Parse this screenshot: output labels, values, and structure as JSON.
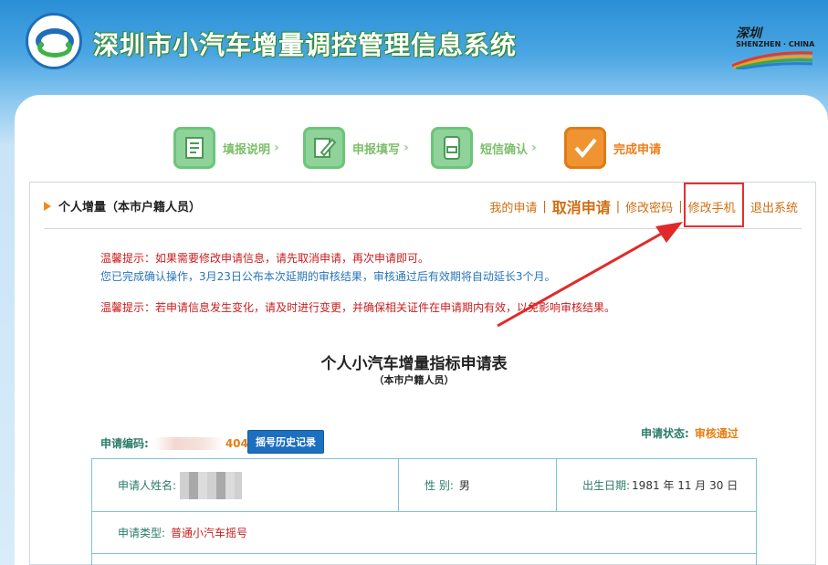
{
  "header": {
    "site_title": "深圳市小汽车增量调控管理信息系统",
    "brand_cn": "深圳",
    "brand_en": "SHENZHEN · CHINA"
  },
  "steps": [
    {
      "label": "填报说明",
      "icon": "document-icon",
      "active": false
    },
    {
      "label": "申报填写",
      "icon": "edit-form-icon",
      "active": false
    },
    {
      "label": "短信确认",
      "icon": "sms-phone-icon",
      "active": false
    },
    {
      "label": "完成申请",
      "icon": "checkmark-icon",
      "active": true
    }
  ],
  "section": {
    "title": "个人增量（本市户籍人员）"
  },
  "nav": {
    "my_application": "我的申请",
    "cancel_application": "取消申请",
    "change_password": "修改密码",
    "change_phone": "修改手机",
    "logout": "退出系统",
    "separator": "|"
  },
  "notices": {
    "notice1": "温馨提示：如果需要修改申请信息，请先取消申请，再次申请即可。",
    "notice2": "您已完成确认操作，3月23日公布本次延期的审核结果，审核通过后有效期将自动延长3个月。",
    "notice3": "温馨提示：若申请信息发生变化，请及时进行变更，并确保相关证件在申请期内有效，以免影响审核结果。"
  },
  "form": {
    "title": "个人小汽车增量指标申请表",
    "subtitle": "（本市户籍人员）",
    "code_label": "申请编码:",
    "code_tail": "404",
    "history_button": "摇号历史记录",
    "status_label": "申请状态:",
    "status_value": "审核通过"
  },
  "table": {
    "name_label": "申请人姓名:",
    "gender_label": "性 别:",
    "gender_value": "男",
    "birth_label": "出生日期:",
    "birth_value": "1981 年 11 月 30 日",
    "type_label": "申请类型:",
    "type_value": "普通小汽车摇号"
  },
  "colors": {
    "accent_orange": "#f07d1a",
    "notice_red": "#c81e1e",
    "notice_blue": "#2a74b8",
    "label_teal": "#2a7b68",
    "button_blue": "#1d6fbf",
    "highlight_red": "#e03030"
  }
}
